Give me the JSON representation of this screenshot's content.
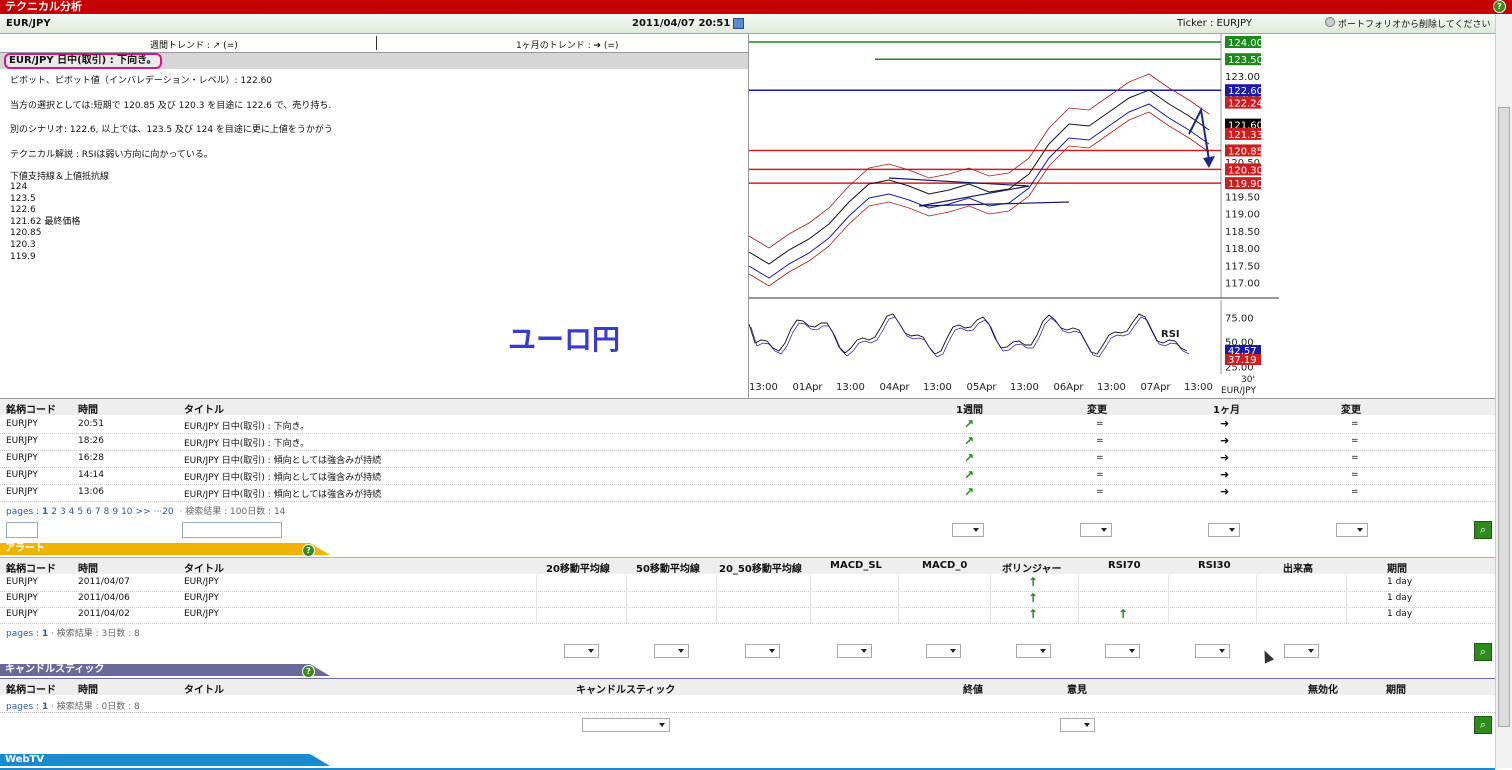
{
  "window_title": "テクニカル分析",
  "header": {
    "symbol": "EUR/JPY",
    "datetime": "2011/04/07 20:51",
    "ticker": "Ticker : EURJPY",
    "remove_link": "ポートフォリオから削除してください"
  },
  "trends": {
    "weekly": "週間トレンド : ↗ (=)",
    "monthly": "1ヶ月のトレンド : ➜ (=)"
  },
  "analysis": {
    "heading": "EUR/JPY 日中(取引) : 下向き。",
    "pivot": "ピボット、ピボット値（インバレデーション・レベル）: 122.60",
    "preferred": "当方の選択としては:短期で 120.85 及び 120.3 を目途に 122.6 で、売り持ち.",
    "alternative": "別のシナリオ: 122.6, 以上では、123.5 及び 124 を目途に更に上値をうかがう",
    "comment": "テクニカル解説 : RSIは弱い方向に向かっている。",
    "levels_title": "下値支持線＆上値抵抗線",
    "levels": [
      "124",
      "123.5",
      "122.6",
      "121.62 最終価格",
      "120.85",
      "120.3",
      "119.9"
    ],
    "watermark": "ユーロ円"
  },
  "chart": {
    "price_levels": [
      {
        "v": "124.00",
        "c": "#1a8a1a"
      },
      {
        "v": "123.50",
        "c": "#1a8a1a"
      },
      {
        "v": "122.60",
        "c": "#1a1aaa"
      },
      {
        "v": "122.24",
        "c": "#cc2020"
      },
      {
        "v": "121.60",
        "c": "#000000"
      },
      {
        "v": "121.33",
        "c": "#cc2020"
      },
      {
        "v": "120.85",
        "c": "#cc2020"
      },
      {
        "v": "120.30",
        "c": "#cc2020"
      },
      {
        "v": "119.90",
        "c": "#cc2020"
      }
    ],
    "y_ticks": [
      "123.00",
      "122.50",
      "121.50",
      "120.50",
      "119.50",
      "119.00",
      "118.50",
      "118.00",
      "117.50",
      "117.00"
    ],
    "rsi_label": "RSI",
    "rsi_ticks": [
      "75.00",
      "50.00",
      "25.00"
    ],
    "rsi_values": [
      {
        "v": "42.57",
        "c": "#1a1aaa"
      },
      {
        "v": "37.19",
        "c": "#cc2020"
      }
    ],
    "x_ticks": [
      "13:00",
      "01Apr",
      "13:00",
      "04Apr",
      "13:00",
      "05Apr",
      "13:00",
      "06Apr",
      "13:00",
      "07Apr",
      "13:00"
    ],
    "period": "30'",
    "pair": "EUR/JPY"
  },
  "news": {
    "columns": [
      "銘柄コード",
      "時間",
      "タイトル",
      "1週間",
      "変更",
      "1ヶ月",
      "変更"
    ],
    "rows": [
      {
        "code": "EURJPY",
        "time": "20:51",
        "title": "EUR/JPY 日中(取引) : 下向き。",
        "week": "↗",
        "chg1": "=",
        "month": "➜",
        "chg2": "="
      },
      {
        "code": "EURJPY",
        "time": "18:26",
        "title": "EUR/JPY 日中(取引) : 下向き。",
        "week": "↗",
        "chg1": "=",
        "month": "➜",
        "chg2": "="
      },
      {
        "code": "EURJPY",
        "time": "16:28",
        "title": "EUR/JPY 日中(取引) : 傾向としては強含みが持続",
        "week": "↗",
        "chg1": "=",
        "month": "➜",
        "chg2": "="
      },
      {
        "code": "EURJPY",
        "time": "14:14",
        "title": "EUR/JPY 日中(取引) : 傾向としては強含みが持続",
        "week": "↗",
        "chg1": "=",
        "month": "➜",
        "chg2": "="
      },
      {
        "code": "EURJPY",
        "time": "13:06",
        "title": "EUR/JPY 日中(取引) : 傾向としては強含みが持続",
        "week": "↗",
        "chg1": "=",
        "month": "➜",
        "chg2": "="
      }
    ],
    "pages_label": "pages :",
    "pages": [
      "1",
      "2",
      "3",
      "4",
      "5",
      "6",
      "7",
      "8",
      "9",
      "10",
      ">>",
      "···20"
    ],
    "result": "· 検索結果 : 100日数 : 14"
  },
  "alerts": {
    "tab": "アラート",
    "columns": [
      "銘柄コード",
      "時間",
      "タイトル",
      "20移動平均線",
      "50移動平均線",
      "20_50移動平均線",
      "MACD_SL",
      "MACD_0",
      "ボリンジャー",
      "RSI70",
      "RSI30",
      "出来高",
      "期間"
    ],
    "rows": [
      {
        "code": "EURJPY",
        "date": "2011/04/07",
        "title": "EUR/JPY",
        "boll": "↑",
        "rsi70": "",
        "period": "1 day"
      },
      {
        "code": "EURJPY",
        "date": "2011/04/06",
        "title": "EUR/JPY",
        "boll": "↑",
        "rsi70": "",
        "period": "1 day"
      },
      {
        "code": "EURJPY",
        "date": "2011/04/02",
        "title": "EUR/JPY",
        "boll": "↑",
        "rsi70": "↑",
        "period": "1 day"
      }
    ],
    "pages_label": "pages :",
    "page": "1",
    "result": "· 検索結果 : 3日数 : 8"
  },
  "candles": {
    "tab": "キャンドルスティック",
    "columns": [
      "銘柄コード",
      "時間",
      "タイトル",
      "キャンドルスティック",
      "終値",
      "意見",
      "無効化",
      "期間"
    ],
    "pages_label": "pages :",
    "page": "1",
    "result": "· 検索結果 : 0日数 : 8"
  },
  "webtv": {
    "tab": "WebTV"
  }
}
